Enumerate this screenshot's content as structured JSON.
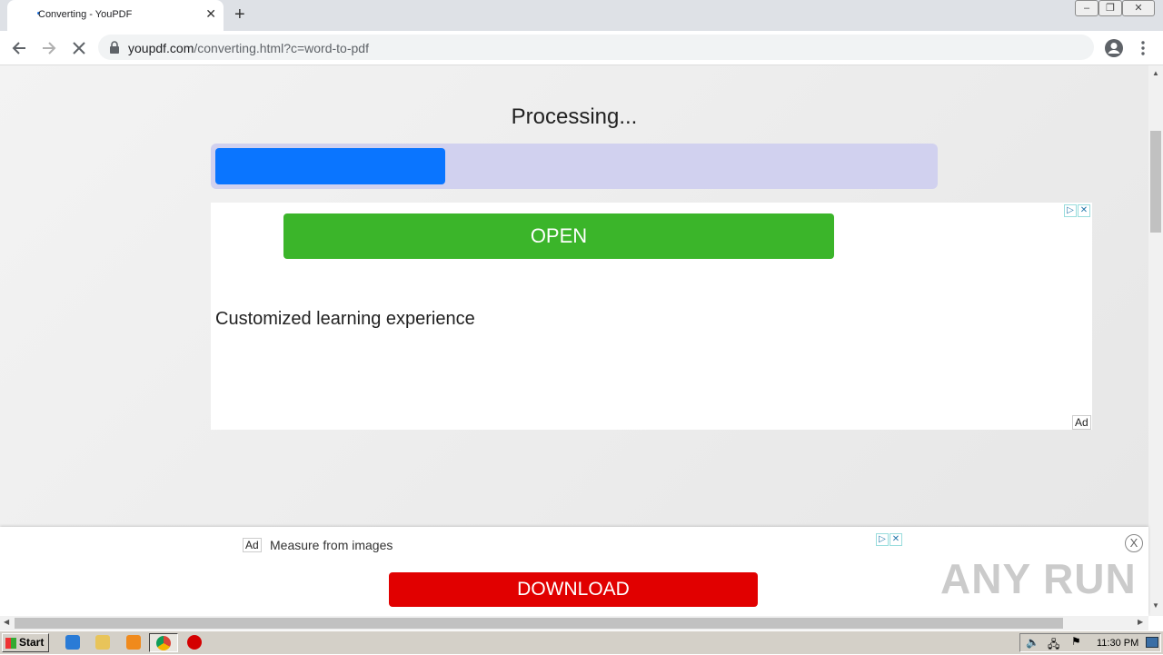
{
  "browser": {
    "tab_title": "Converting - YouPDF",
    "tab_close": "✕",
    "new_tab": "+",
    "url_host": "youpdf.com",
    "url_path": "/converting.html?c=word-to-pdf"
  },
  "window_controls": {
    "minimize": "–",
    "restore": "❐",
    "close": "✕"
  },
  "page": {
    "processing_text": "Processing...",
    "progress": 0.32,
    "progress_color": "#0a75ff",
    "track_color": "#d1d1ef"
  },
  "ad_top": {
    "button_label": "OPEN",
    "button_color": "#3bb52a",
    "text": "Customized learning experience",
    "ad_label": "Ad"
  },
  "ad_bottom": {
    "ad_label": "Ad",
    "text": "Measure from images",
    "button_label": "DOWNLOAD",
    "button_color": "#e10000",
    "close_label": "X"
  },
  "watermark": "ANY RUN",
  "taskbar": {
    "start_label": "Start",
    "clock": "11:30 PM"
  }
}
